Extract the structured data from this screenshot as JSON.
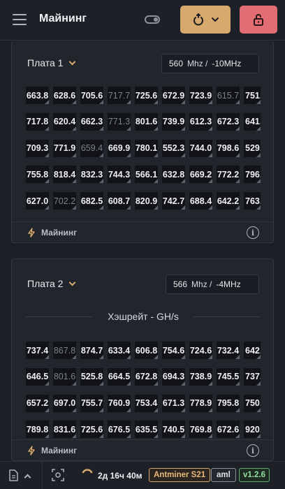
{
  "header": {
    "title": "Майнинг",
    "icons": {
      "menu": "hamburger-icon",
      "toggle": "toggle-icon",
      "reboot": "power-cycle-icon",
      "dropdown": "chevron-down-icon",
      "unlock": "unlock-icon"
    }
  },
  "boards": [
    {
      "label": "Плата 1",
      "freq": "560",
      "freq_unit": "Mhz /",
      "offset": "-10MHz",
      "hashrate_label": "",
      "rows": [
        [
          "663.8",
          "628.6",
          "705.6",
          "717.7",
          "725.6",
          "672.9",
          "723.9",
          "615.7",
          "751."
        ],
        [
          "717.8",
          "620.4",
          "662.3",
          "771.3",
          "801.6",
          "739.9",
          "612.3",
          "672.3",
          "641."
        ],
        [
          "709.3",
          "771.9",
          "659.4",
          "669.9",
          "780.1",
          "552.3",
          "744.0",
          "798.6",
          "529."
        ],
        [
          "755.8",
          "818.4",
          "832.3",
          "744.3",
          "566.1",
          "632.8",
          "669.2",
          "772.2",
          "796."
        ],
        [
          "627.0",
          "702.2",
          "682.5",
          "608.7",
          "820.9",
          "742.7",
          "688.4",
          "642.2",
          "763."
        ]
      ],
      "dim": [
        [
          0,
          3
        ],
        [
          0,
          7
        ],
        [
          1,
          3
        ],
        [
          2,
          2
        ],
        [
          4,
          1
        ]
      ],
      "footer_label": "Майнинг"
    },
    {
      "label": "Плата 2",
      "freq": "566",
      "freq_unit": "Mhz /",
      "offset": "-4MHz",
      "hashrate_label": "Хэшрейт - GH/s",
      "rows": [
        [
          "737.4",
          "867.8",
          "874.7",
          "633.4",
          "606.8",
          "754.6",
          "724.6",
          "732.4",
          "642."
        ],
        [
          "646.5",
          "801.6",
          "525.8",
          "664.5",
          "672.8",
          "694.3",
          "738.9",
          "745.5",
          "737."
        ],
        [
          "657.2",
          "697.0",
          "755.7",
          "760.9",
          "753.4",
          "671.3",
          "778.9",
          "795.8",
          "750."
        ],
        [
          "789.8",
          "831.6",
          "725.6",
          "676.5",
          "635.5",
          "740.5",
          "769.8",
          "672.6",
          "920."
        ]
      ],
      "dim": [
        [
          0,
          1
        ],
        [
          1,
          1
        ]
      ],
      "footer_label": "Майнинг"
    }
  ],
  "bottombar": {
    "uptime": "2д 16ч 40м",
    "model": "Antminer S21",
    "algo": "aml",
    "version": "v1.2.6"
  },
  "colors": {
    "accent": "#d8a96c",
    "danger": "#e26d73",
    "ok": "#57b36a"
  }
}
